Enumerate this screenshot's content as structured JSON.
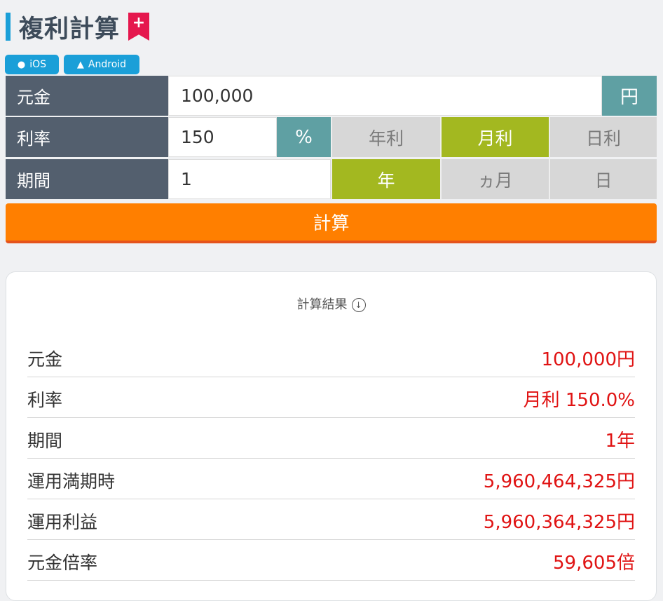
{
  "header": {
    "title": "複利計算",
    "bookmark_symbol": "+"
  },
  "apps": {
    "ios_label": "iOS",
    "android_label": "Android"
  },
  "form": {
    "principal": {
      "label": "元金",
      "value": "100,000",
      "unit": "円"
    },
    "rate": {
      "label": "利率",
      "value": "150",
      "unit": "%",
      "options": [
        "年利",
        "月利",
        "日利"
      ],
      "selected": "月利"
    },
    "period": {
      "label": "期間",
      "value": "1",
      "options": [
        "年",
        "ヵ月",
        "日"
      ],
      "selected": "年"
    },
    "calculate_label": "計算"
  },
  "result": {
    "heading": "計算結果",
    "rows": [
      {
        "label": "元金",
        "value": "100,000円"
      },
      {
        "label": "利率",
        "value": "月利 150.0%"
      },
      {
        "label": "期間",
        "value": "1年"
      },
      {
        "label": "運用満期時",
        "value": "5,960,464,325円"
      },
      {
        "label": "運用利益",
        "value": "5,960,364,325円"
      },
      {
        "label": "元金倍率",
        "value": "59,605倍"
      }
    ]
  },
  "colors": {
    "accent_blue": "#1a9fd8",
    "label_bg": "#535f6e",
    "unit_bg": "#5fa0a3",
    "selected_bg": "#a3b820",
    "button_orange": "#ff7f00",
    "result_red": "#e01313"
  }
}
